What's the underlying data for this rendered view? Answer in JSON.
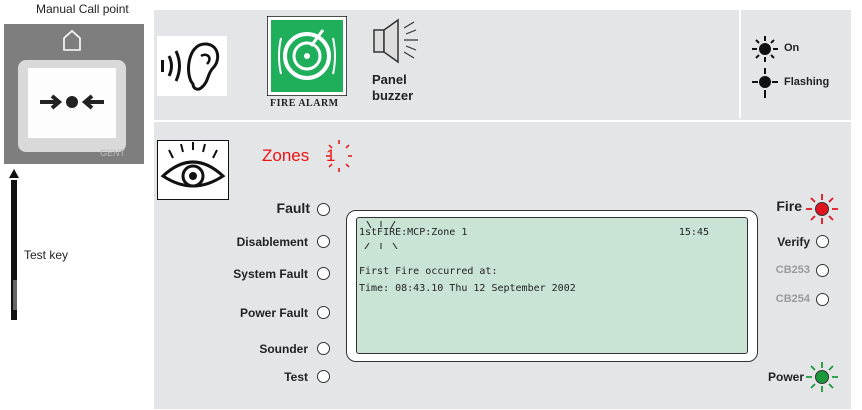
{
  "callpoint": {
    "title": "Manual Call point",
    "brand": "GENT"
  },
  "test_key_label": "Test key",
  "top": {
    "fire_alarm_label": "FIRE ALARM",
    "panel_buzzer_label": "Panel\nbuzzer",
    "legend": {
      "on": "On",
      "flashing": "Flashing"
    }
  },
  "zones": {
    "label": "Zones",
    "number": "1"
  },
  "left_status": [
    {
      "label": "Fault",
      "key": "fault"
    },
    {
      "label": "Disablement",
      "key": "disablement"
    },
    {
      "label": "System Fault",
      "key": "system-fault"
    },
    {
      "label": "Power Fault",
      "key": "power-fault"
    },
    {
      "label": "Sounder",
      "key": "sounder"
    },
    {
      "label": "Test",
      "key": "test"
    }
  ],
  "right_status": {
    "fire": "Fire",
    "verify": "Verify",
    "cb253": "CB253",
    "cb254": "CB254",
    "power": "Power"
  },
  "lcd": {
    "line1_left": "1stFIRE:MCP:Zone 1",
    "line1_right": "15:45",
    "line3": "First Fire occurred at:",
    "line4": "Time: 08:43.10  Thu  12  September 2002"
  },
  "colors": {
    "fire_lamp": "#e0141e",
    "power_lamp": "#1a9a3a",
    "fire_alarm_green": "#1fae5a",
    "zones_red": "#e11111"
  }
}
